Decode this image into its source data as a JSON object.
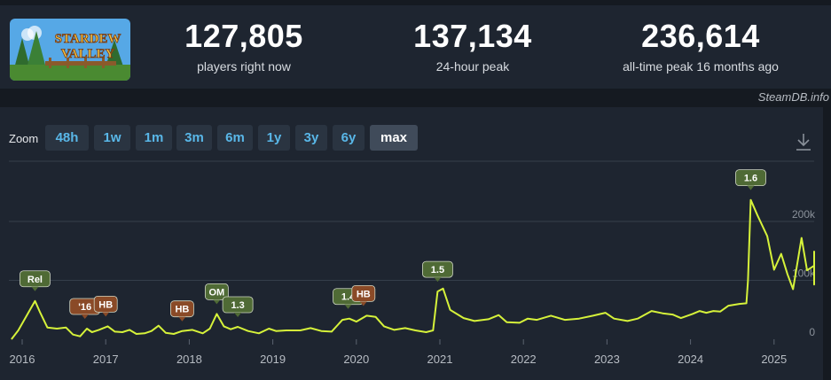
{
  "header": {
    "logo_text": "STARDEW VALLEY",
    "stats": [
      {
        "value": "127,805",
        "label": "players right now"
      },
      {
        "value": "137,134",
        "label": "24-hour peak"
      },
      {
        "value": "236,614",
        "label": "all-time peak 16 months ago"
      }
    ],
    "credit": "SteamDB.info"
  },
  "zoom": {
    "label": "Zoom",
    "buttons": [
      "48h",
      "1w",
      "1m",
      "3m",
      "6m",
      "1y",
      "3y",
      "6y",
      "max"
    ],
    "active": "max"
  },
  "colors": {
    "line": "#d6f23a",
    "green_flag": "#4f6a35",
    "orange_flag": "#8a4a27",
    "grid": "#353e4a"
  },
  "chart_data": {
    "type": "line",
    "title": "",
    "xlabel": "",
    "ylabel": "",
    "x_tick_labels": [
      "2016",
      "2017",
      "2018",
      "2019",
      "2020",
      "2021",
      "2022",
      "2023",
      "2024",
      "2025"
    ],
    "y_tick_labels": [
      "0",
      "100k",
      "200k"
    ],
    "ylim": [
      0,
      280000
    ],
    "series": [
      {
        "points": [
          [
            "2015-11-15",
            0
          ],
          [
            "2015-12-15",
            15000
          ],
          [
            "2016-02-26",
            65000
          ],
          [
            "2016-03-20",
            45000
          ],
          [
            "2016-04-20",
            20000
          ],
          [
            "2016-06-01",
            18000
          ],
          [
            "2016-07-10",
            20000
          ],
          [
            "2016-08-10",
            8000
          ],
          [
            "2016-09-10",
            5000
          ],
          [
            "2016-10-10",
            18000
          ],
          [
            "2016-11-01",
            12000
          ],
          [
            "2016-12-01",
            16000
          ],
          [
            "2017-01-10",
            22000
          ],
          [
            "2017-02-10",
            13000
          ],
          [
            "2017-03-15",
            12000
          ],
          [
            "2017-04-15",
            16000
          ],
          [
            "2017-05-15",
            9000
          ],
          [
            "2017-06-20",
            10000
          ],
          [
            "2017-07-20",
            14000
          ],
          [
            "2017-08-20",
            23000
          ],
          [
            "2017-09-20",
            11000
          ],
          [
            "2017-10-25",
            9000
          ],
          [
            "2017-12-01",
            14000
          ],
          [
            "2018-01-15",
            16000
          ],
          [
            "2018-03-01",
            10000
          ],
          [
            "2018-04-01",
            18000
          ],
          [
            "2018-05-01",
            43000
          ],
          [
            "2018-06-01",
            22000
          ],
          [
            "2018-07-01",
            17000
          ],
          [
            "2018-08-01",
            21000
          ],
          [
            "2018-09-15",
            14000
          ],
          [
            "2018-11-01",
            10000
          ],
          [
            "2018-12-15",
            18000
          ],
          [
            "2019-01-15",
            14000
          ],
          [
            "2019-03-01",
            15000
          ],
          [
            "2019-05-01",
            15000
          ],
          [
            "2019-06-15",
            19000
          ],
          [
            "2019-08-01",
            14000
          ],
          [
            "2019-09-15",
            13000
          ],
          [
            "2019-11-01",
            33000
          ],
          [
            "2019-12-01",
            35000
          ],
          [
            "2020-01-01",
            30000
          ],
          [
            "2020-02-15",
            40000
          ],
          [
            "2020-03-25",
            38000
          ],
          [
            "2020-05-01",
            22000
          ],
          [
            "2020-06-15",
            16000
          ],
          [
            "2020-08-01",
            19000
          ],
          [
            "2020-09-15",
            15000
          ],
          [
            "2020-11-01",
            12000
          ],
          [
            "2020-12-01",
            15000
          ],
          [
            "2020-12-21",
            81000
          ],
          [
            "2021-01-15",
            86000
          ],
          [
            "2021-02-15",
            50000
          ],
          [
            "2021-04-15",
            36000
          ],
          [
            "2021-06-01",
            31000
          ],
          [
            "2021-08-01",
            34000
          ],
          [
            "2021-09-15",
            41000
          ],
          [
            "2021-10-20",
            29000
          ],
          [
            "2021-12-15",
            28000
          ],
          [
            "2022-01-20",
            35000
          ],
          [
            "2022-03-01",
            33000
          ],
          [
            "2022-05-01",
            40000
          ],
          [
            "2022-07-01",
            33000
          ],
          [
            "2022-09-01",
            35000
          ],
          [
            "2022-11-01",
            40000
          ],
          [
            "2022-12-25",
            45000
          ],
          [
            "2023-02-01",
            35000
          ],
          [
            "2023-04-01",
            31000
          ],
          [
            "2023-05-15",
            35000
          ],
          [
            "2023-07-15",
            48000
          ],
          [
            "2023-09-01",
            44000
          ],
          [
            "2023-10-15",
            42000
          ],
          [
            "2023-11-20",
            36000
          ],
          [
            "2024-01-10",
            43000
          ],
          [
            "2024-02-10",
            48000
          ],
          [
            "2024-03-10",
            45000
          ],
          [
            "2024-04-10",
            48000
          ],
          [
            "2024-05-10",
            47000
          ],
          [
            "2024-06-15",
            57000
          ],
          [
            "2024-08-01",
            60000
          ],
          [
            "2024-09-01",
            61000
          ],
          [
            "2024-09-08",
            100000
          ],
          [
            "2024-09-20",
            236614
          ],
          [
            "2024-10-20",
            210000
          ],
          [
            "2024-12-01",
            175000
          ],
          [
            "2024-12-31",
            118000
          ],
          [
            "2025-02-01",
            145000
          ],
          [
            "2025-03-01",
            110000
          ],
          [
            "2025-03-25",
            85000
          ],
          [
            "2025-05-01",
            172000
          ],
          [
            "2025-05-25",
            117000
          ],
          [
            "2025-07-01",
            125000
          ],
          [
            "2025-08-01",
            124000
          ],
          [
            "2025-09-01",
            93000
          ],
          [
            "2025-09-25",
            134000
          ],
          [
            "2025-11-01",
            106000
          ],
          [
            "2025-11-25",
            97000
          ],
          [
            "2025-12-20",
            122000
          ],
          [
            "2026-01-20",
            150000
          ]
        ]
      }
    ],
    "annotations": [
      {
        "label": "Rel",
        "date": "2016-02-26",
        "kind": "green"
      },
      {
        "label": "'16",
        "date": "2016-10-01",
        "kind": "orange"
      },
      {
        "label": "HB",
        "date": "2017-01-01",
        "kind": "orange"
      },
      {
        "label": "HB",
        "date": "2017-12-01",
        "kind": "orange"
      },
      {
        "label": "OM",
        "date": "2018-05-01",
        "kind": "green"
      },
      {
        "label": "1.3",
        "date": "2018-08-01",
        "kind": "green"
      },
      {
        "label": "1.4",
        "date": "2019-11-26",
        "kind": "green"
      },
      {
        "label": "HB",
        "date": "2020-02-01",
        "kind": "orange"
      },
      {
        "label": "1.5",
        "date": "2020-12-21",
        "kind": "green"
      },
      {
        "label": "1.6",
        "date": "2024-09-20",
        "kind": "green"
      }
    ]
  }
}
